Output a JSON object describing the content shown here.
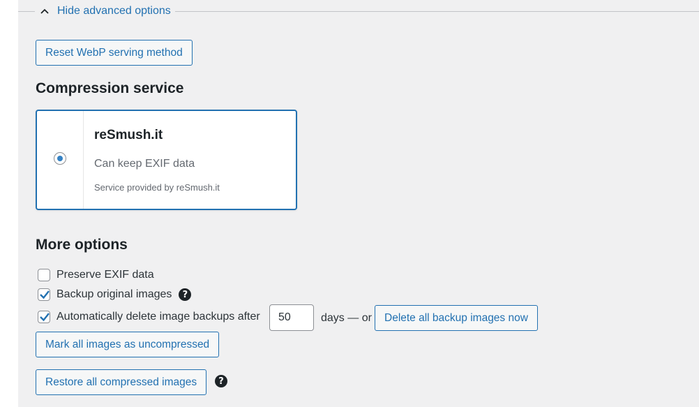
{
  "advanced": {
    "toggle_label": "Hide advanced options"
  },
  "reset_webp_label": "Reset WebP serving method",
  "compression": {
    "heading": "Compression service",
    "service_name": "reSmush.it",
    "service_feature": "Can keep EXIF data",
    "service_note": "Service provided by reSmush.it",
    "selected": true
  },
  "more_options": {
    "heading": "More options",
    "preserve_exif": {
      "label": "Preserve EXIF data",
      "checked": false
    },
    "backup_originals": {
      "label": "Backup original images",
      "checked": true
    },
    "auto_delete": {
      "label": "Automatically delete image backups after",
      "checked": true,
      "days_value": "50",
      "days_suffix": "days — or"
    },
    "delete_backups_label": "Delete all backup images now",
    "mark_uncompressed_label": "Mark all images as uncompressed",
    "restore_label": "Restore all compressed images",
    "help_glyph": "?"
  },
  "colors": {
    "accent": "#2271b1",
    "radio_fill": "#3582c4",
    "background": "#f0f0f1"
  }
}
